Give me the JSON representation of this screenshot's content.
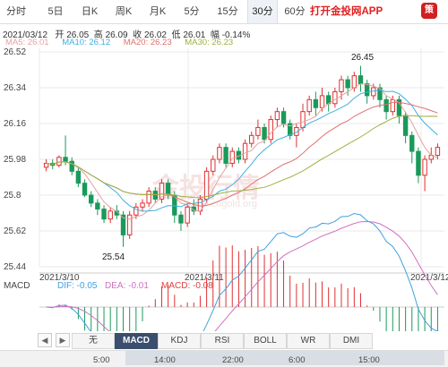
{
  "tabs": [
    {
      "label": "分时"
    },
    {
      "label": "5日"
    },
    {
      "label": "日K"
    },
    {
      "label": "周K"
    },
    {
      "label": "月K"
    },
    {
      "label": "5分"
    },
    {
      "label": "15分"
    },
    {
      "label": "30分",
      "active": true
    },
    {
      "label": "60分"
    }
  ],
  "app_button": "打开金投网APP",
  "app_icon_text": "策",
  "info": {
    "date": "2021/03/12",
    "open_label": "开",
    "open": "26.05",
    "high_label": "高",
    "high": "26.09",
    "close_label": "收",
    "close": "26.02",
    "low_label": "低",
    "low": "26.01",
    "chg_label": "幅",
    "chg": "-0.14%"
  },
  "ma": [
    {
      "label": "MA5: 26.01",
      "color": "#e8a0a0"
    },
    {
      "label": "MA10: 26.12",
      "color": "#40b0e0"
    },
    {
      "label": "MA20: 26.23",
      "color": "#e07070"
    },
    {
      "label": "MA30: 26.23",
      "color": "#a0b040"
    }
  ],
  "price_axis": [
    "26.52",
    "26.34",
    "26.16",
    "25.98",
    "25.8",
    "25.62",
    "25.44"
  ],
  "annotations": {
    "high": "26.45",
    "low": "25.54"
  },
  "date_labels": [
    "2021/3/10",
    "2021/3/11",
    "2021/3/12"
  ],
  "macd": {
    "macd_label": "MACD",
    "dif_label": "DIF: -0.05",
    "dea_label": "DEA: -0.01",
    "macd_val_label": "MACD: -0.08",
    "dif_color": "#40a0e0",
    "dea_color": "#d070c0",
    "macd_color": "#e04040"
  },
  "indicators": [
    {
      "label": "无"
    },
    {
      "label": "MACD",
      "active": true
    },
    {
      "label": "KDJ"
    },
    {
      "label": "RSI"
    },
    {
      "label": "BOLL"
    },
    {
      "label": "WR"
    },
    {
      "label": "DMI"
    }
  ],
  "scroll_times": [
    "5:00",
    "14:00",
    "22:00",
    "6:00",
    "15:00"
  ],
  "watermark": "金投行情",
  "watermark_url": "quote.cngold.org",
  "colors": {
    "up": "#e03030",
    "down": "#1a9a5a",
    "grid": "#e8e8e8"
  },
  "chart_data": {
    "type": "candlestick",
    "ylim": [
      25.44,
      26.52
    ],
    "candles": [
      [
        25.94,
        25.96,
        25.92,
        25.98
      ],
      [
        25.96,
        25.95,
        25.93,
        25.98
      ],
      [
        25.95,
        25.99,
        25.94,
        26.0
      ],
      [
        25.99,
        25.97,
        25.95,
        26.1
      ],
      [
        25.97,
        25.92,
        25.9,
        25.99
      ],
      [
        25.92,
        25.86,
        25.84,
        25.94
      ],
      [
        25.86,
        25.8,
        25.79,
        25.88
      ],
      [
        25.8,
        25.76,
        25.74,
        25.82
      ],
      [
        25.76,
        25.73,
        25.7,
        25.78
      ],
      [
        25.73,
        25.68,
        25.66,
        25.75
      ],
      [
        25.68,
        25.72,
        25.66,
        25.74
      ],
      [
        25.72,
        25.7,
        25.68,
        25.75
      ],
      [
        25.7,
        25.6,
        25.54,
        25.72
      ],
      [
        25.6,
        25.7,
        25.58,
        25.72
      ],
      [
        25.7,
        25.74,
        25.68,
        25.76
      ],
      [
        25.74,
        25.76,
        25.72,
        25.78
      ],
      [
        25.76,
        25.82,
        25.74,
        25.84
      ],
      [
        25.82,
        25.78,
        25.76,
        25.84
      ],
      [
        25.78,
        25.86,
        25.76,
        25.88
      ],
      [
        25.86,
        25.8,
        25.78,
        25.88
      ],
      [
        25.8,
        25.7,
        25.66,
        25.82
      ],
      [
        25.7,
        25.66,
        25.62,
        25.72
      ],
      [
        25.66,
        25.74,
        25.64,
        25.76
      ],
      [
        25.74,
        25.72,
        25.7,
        25.78
      ],
      [
        25.72,
        25.78,
        25.7,
        25.8
      ],
      [
        25.78,
        25.92,
        25.76,
        25.94
      ],
      [
        25.92,
        25.98,
        25.9,
        26.0
      ],
      [
        25.98,
        26.04,
        25.96,
        26.06
      ],
      [
        26.04,
        25.96,
        25.94,
        26.06
      ],
      [
        25.96,
        26.02,
        25.94,
        26.04
      ],
      [
        26.02,
        25.98,
        25.96,
        26.04
      ],
      [
        25.98,
        26.06,
        25.96,
        26.08
      ],
      [
        26.06,
        26.1,
        26.04,
        26.12
      ],
      [
        26.1,
        26.14,
        26.08,
        26.18
      ],
      [
        26.14,
        26.08,
        26.06,
        26.16
      ],
      [
        26.08,
        26.18,
        26.06,
        26.2
      ],
      [
        26.18,
        26.22,
        26.14,
        26.24
      ],
      [
        26.22,
        26.16,
        26.14,
        26.24
      ],
      [
        26.16,
        26.1,
        26.08,
        26.18
      ],
      [
        26.1,
        26.14,
        26.04,
        26.16
      ],
      [
        26.14,
        26.22,
        26.12,
        26.26
      ],
      [
        26.22,
        26.28,
        26.2,
        26.3
      ],
      [
        26.28,
        26.24,
        26.2,
        26.32
      ],
      [
        26.24,
        26.3,
        26.22,
        26.34
      ],
      [
        26.3,
        26.26,
        26.22,
        26.32
      ],
      [
        26.26,
        26.32,
        26.24,
        26.34
      ],
      [
        26.32,
        26.38,
        26.28,
        26.4
      ],
      [
        26.38,
        26.34,
        26.3,
        26.4
      ],
      [
        26.34,
        26.4,
        26.32,
        26.42
      ],
      [
        26.4,
        26.36,
        26.32,
        26.45
      ],
      [
        26.36,
        26.3,
        26.26,
        26.38
      ],
      [
        26.3,
        26.34,
        26.28,
        26.36
      ],
      [
        26.34,
        26.28,
        26.24,
        26.36
      ],
      [
        26.28,
        26.22,
        26.18,
        26.3
      ],
      [
        26.22,
        26.28,
        26.2,
        26.3
      ],
      [
        26.28,
        26.2,
        26.16,
        26.3
      ],
      [
        26.2,
        26.1,
        26.06,
        26.22
      ],
      [
        26.1,
        26.02,
        25.96,
        26.12
      ],
      [
        26.02,
        25.9,
        25.86,
        26.04
      ],
      [
        25.9,
        25.98,
        25.82,
        26.0
      ],
      [
        25.98,
        26.0,
        25.96,
        26.04
      ],
      [
        26.0,
        26.04,
        25.98,
        26.06
      ]
    ]
  }
}
